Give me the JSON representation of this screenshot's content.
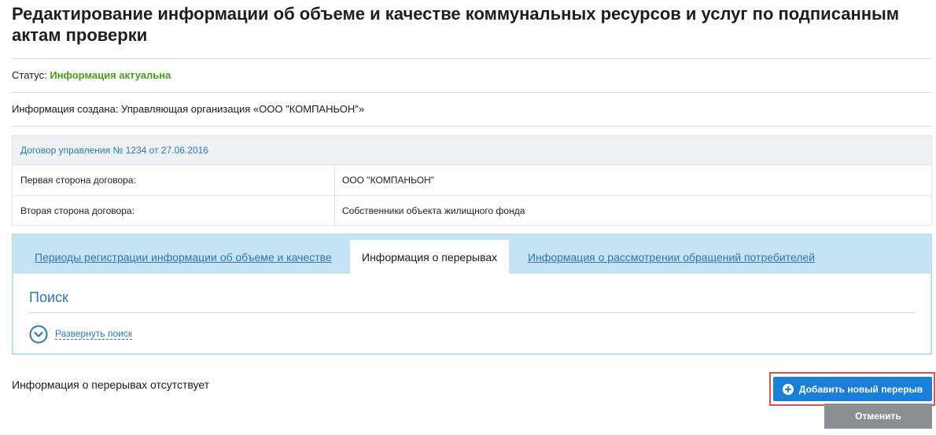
{
  "page": {
    "title": "Редактирование информации об объеме и качестве коммунальных ресурсов и услуг по подписанным актам проверки"
  },
  "status": {
    "label": "Статус:",
    "value": "Информация актуальна",
    "color": "#4b9a1e"
  },
  "created": {
    "text": "Информация создана: Управляющая организация «ООО \"КОМПАНЬОН\"»"
  },
  "contract": {
    "header": "Договор управления № 1234 от 27.06.2016",
    "rows": [
      {
        "label": "Первая сторона договора:",
        "value": "ООО \"КОМПАНЬОН\""
      },
      {
        "label": "Вторая сторона договора:",
        "value": "Собственники объекта жилищного фонда"
      }
    ]
  },
  "tabs": [
    {
      "label": "Периоды регистрации информации об объеме и качестве",
      "active": false
    },
    {
      "label": "Информация о перерывах",
      "active": true
    },
    {
      "label": "Информация о рассмотрении обращений потребителей",
      "active": false
    }
  ],
  "search": {
    "title": "Поиск",
    "expand_label": "Развернуть поиск",
    "expand_icon": "chevron-down-circle-icon"
  },
  "empty_message": "Информация о перерывах отсутствует",
  "actions": {
    "add_label": "Добавить новый перерыв",
    "add_icon": "plus-circle-icon",
    "cancel_label": "Отменить"
  },
  "colors": {
    "accent": "#2f76b1",
    "primary_button": "#1b7fd8",
    "secondary_button": "#8b8f93",
    "highlight_frame": "#d9534f",
    "tabs_background": "#c6e2f5"
  }
}
